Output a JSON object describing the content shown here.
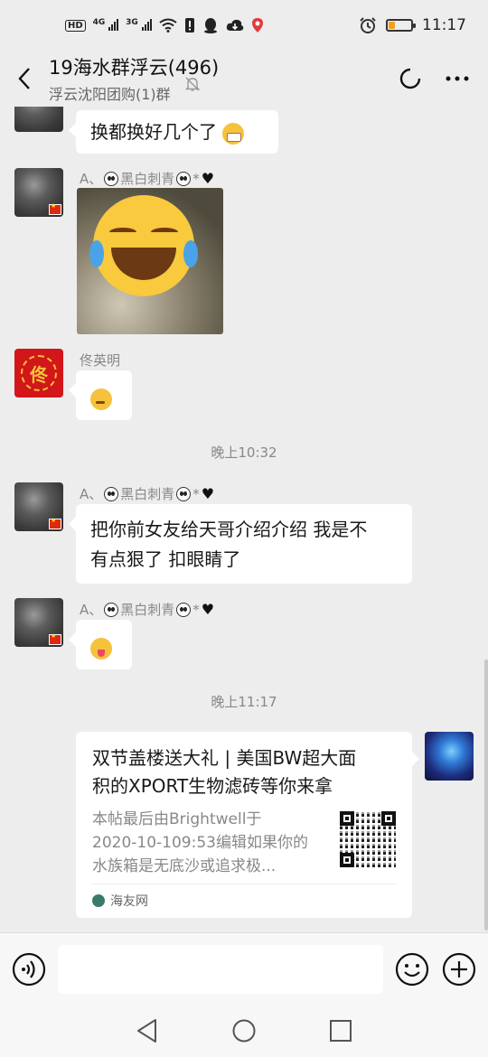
{
  "status_bar": {
    "hd_label": "HD",
    "net1": "4G",
    "net2": "3G",
    "time": "11:17"
  },
  "header": {
    "title": "19海水群浮云(496)",
    "subtitle": "浮云沈阳团购(1)群"
  },
  "messages": {
    "m1": {
      "text": "换都换好几个了"
    },
    "m2": {
      "sender": "A、",
      "sender_mid": "黑白刺青",
      "sender_end": "*"
    },
    "m3": {
      "sender": "佟英明",
      "avatar_char": "佟"
    },
    "time1": "晚上10:32",
    "m4": {
      "sender": "A、",
      "sender_mid": "黑白刺青",
      "sender_end": "*",
      "text_line1": "把你前女友给天哥介绍介绍 我是不",
      "text_line2": "有点狠了 扣眼睛了"
    },
    "m5": {
      "sender": "A、",
      "sender_mid": "黑白刺青",
      "sender_end": "*"
    },
    "time2": "晚上11:17",
    "card": {
      "title_line1": "双节盖楼送大礼 | 美国BW超大面",
      "title_line2": "积的XPORT生物滤砖等你来拿",
      "desc_line1": "本帖最后由Brightwell于",
      "desc_line2": "2020-10-109:53编辑如果你的",
      "desc_line3": "水族箱是无底沙或追求极...",
      "source": "海友网"
    }
  },
  "colors": {
    "background": "#ededed",
    "bubble": "#ffffff",
    "battery_fill": "#f0a020"
  },
  "battery_level": 0.25,
  "icons": [
    "back-icon",
    "mute-icon",
    "circle-icon",
    "more-icon",
    "voice-icon",
    "emoji-icon",
    "plus-icon",
    "nav-back-icon",
    "nav-home-icon",
    "nav-recents-icon"
  ]
}
